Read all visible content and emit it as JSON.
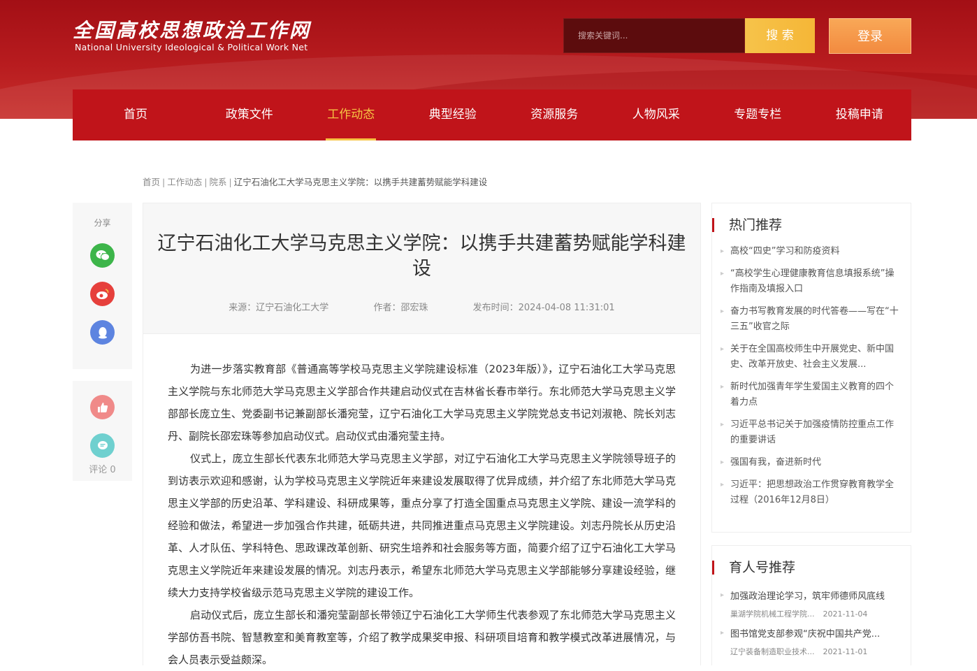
{
  "header": {
    "logo_cn": "全国高校思想政治工作网",
    "logo_en": "National University Ideological & Political Work Net",
    "search_placeholder": "搜索关键词...",
    "search_button": "搜 索",
    "login_button": "登录"
  },
  "nav": {
    "items": [
      {
        "label": "首页"
      },
      {
        "label": "政策文件"
      },
      {
        "label": "工作动态"
      },
      {
        "label": "典型经验"
      },
      {
        "label": "资源服务"
      },
      {
        "label": "人物风采"
      },
      {
        "label": "专题专栏"
      },
      {
        "label": "投稿申请"
      }
    ],
    "active_index": 2
  },
  "breadcrumb": {
    "home": "首页",
    "section": "工作动态",
    "subsection": "院系",
    "current": "辽宁石油化工大学马克思主义学院：以携手共建蓄势赋能学科建设"
  },
  "share": {
    "label": "分享",
    "comment_label": "评论 0",
    "colors": {
      "wechat": "#3db54a",
      "weibo": "#e6403c",
      "qq": "#5d84e0",
      "like": "#f08a89",
      "comment": "#6fd0cf"
    }
  },
  "article": {
    "title": "辽宁石油化工大学马克思主义学院：以携手共建蓄势赋能学科建设",
    "source": "来源：辽宁石油化工大学",
    "author": "作者：邵宏珠",
    "published": "发布时间：2024-04-08 11:31:01",
    "paragraphs": [
      "为进一步落实教育部《普通高等学校马克思主义学院建设标准（2023年版）》，辽宁石油化工大学马克思主义学院与东北师范大学马克思主义学部合作共建启动仪式在吉林省长春市举行。东北师范大学马克思主义学部部长庞立生、党委副书记兼副部长潘宛莹，辽宁石油化工大学马克思主义学院党总支书记刘淑艳、院长刘志丹、副院长邵宏珠等参加启动仪式。启动仪式由潘宛莹主持。",
      "仪式上，庞立生部长代表东北师范大学马克思主义学部，对辽宁石油化工大学马克思主义学院领导班子的到访表示欢迎和感谢，认为学校马克思主义学院近年来建设发展取得了优异成绩，并介绍了东北师范大学马克思主义学部的历史沿革、学科建设、科研成果等，重点分享了打造全国重点马克思主义学院、建设一流学科的经验和做法，希望进一步加强合作共建，砥砺共进，共同推进重点马克思主义学院建设。刘志丹院长从历史沿革、人才队伍、学科特色、思政课改革创新、研究生培养和社会服务等方面，简要介绍了辽宁石油化工大学马克思主义学院近年来建设发展的情况。刘志丹表示，希望东北师范大学马克思主义学部能够分享建设经验，继续大力支持学校省级示范马克思主义学院的建设工作。",
      "启动仪式后，庞立生部长和潘宛莹副部长带领辽宁石油化工大学师生代表参观了东北师范大学马克思主义学部仿吾书院、智慧教室和美育教室等，介绍了教学成果奖申报、科研项目培育和教学模式改革进展情况，与会人员表示受益颇深。"
    ]
  },
  "hot": {
    "title": "热门推荐",
    "items": [
      "高校“四史”学习和防疫资料",
      "“高校学生心理健康教育信息填报系统”操作指南及填报入口",
      "奋力书写教育发展的时代答卷——写在“十三五”收官之际",
      "关于在全国高校师生中开展党史、新中国史、改革开放史、社会主义发展...",
      "新时代加强青年学生爱国主义教育的四个着力点",
      "习近平总书记关于加强疫情防控重点工作的重要讲话",
      "强国有我，奋进新时代",
      "习近平：把思想政治工作贯穿教育教学全过程（2016年12月8日）"
    ]
  },
  "yuren": {
    "title": "育人号推荐",
    "items": [
      {
        "title": "加强政治理论学习，筑牢师德师风底线",
        "org": "巢湖学院机械工程学院...",
        "date": "2021-11-04"
      },
      {
        "title": "图书馆党支部参观“庆祝中国共产党...",
        "org": "辽宁装备制造职业技术...",
        "date": "2021-11-01"
      }
    ]
  }
}
